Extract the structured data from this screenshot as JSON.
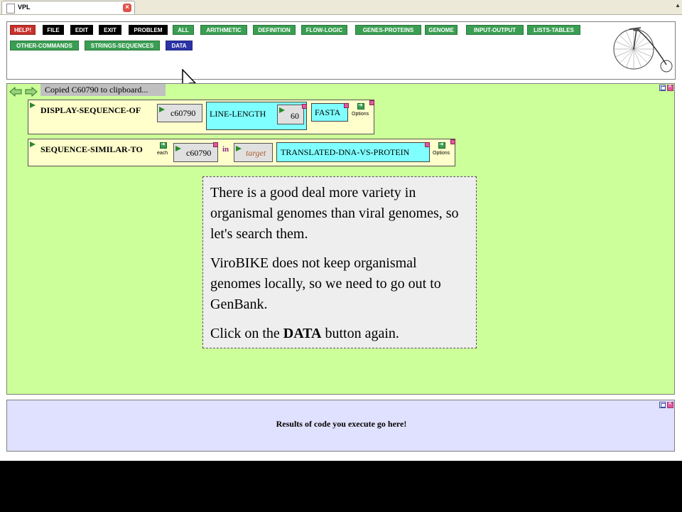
{
  "tab": {
    "title": "VPL",
    "close_icon": "tab-close-icon"
  },
  "toolbar": {
    "row1": [
      {
        "label": "HELP!",
        "color": "red"
      },
      {
        "label": "FILE",
        "color": "black"
      },
      {
        "label": "EDIT",
        "color": "black"
      },
      {
        "label": "EXIT",
        "color": "black"
      },
      {
        "label": "PROBLEM",
        "color": "black"
      },
      {
        "label": "ALL",
        "color": "green"
      },
      {
        "label": "ARITHMETIC",
        "color": "green"
      },
      {
        "label": "DEFINITION",
        "color": "green"
      },
      {
        "label": "FLOW-LOGIC",
        "color": "green"
      },
      {
        "label": "GENES-PROTEINS",
        "color": "green"
      },
      {
        "label": "GENOME",
        "color": "green"
      },
      {
        "label": "INPUT-OUTPUT",
        "color": "green"
      },
      {
        "label": "LISTS-TABLES",
        "color": "green"
      }
    ],
    "row2": [
      {
        "label": "OTHER-COMMANDS",
        "color": "green"
      },
      {
        "label": "STRINGS-SEQUENCES",
        "color": "green"
      },
      {
        "label": "DATA",
        "color": "blue"
      }
    ]
  },
  "workspace": {
    "clipboard_message": "Copied C60790 to clipboard...",
    "box1": {
      "label": "DISPLAY-SEQUENCE-OF",
      "arg1": "c60790",
      "line_length_label": "LINE-LENGTH",
      "line_length_value": "60",
      "format": "FASTA",
      "options_label": "Options"
    },
    "box2": {
      "label": "SEQUENCE-SIMILAR-TO",
      "each_label": "each",
      "arg1": "c60790",
      "in_label": "in",
      "target_placeholder": "target",
      "method": "TRANSLATED-DNA-VS-PROTEIN",
      "options_label": "Options"
    }
  },
  "note": {
    "p1": "There is a good deal more variety in organismal genomes than viral genomes, so let's search them.",
    "p2": "ViroBIKE does not keep organismal genomes locally, so we need to go out to GenBank.",
    "p3_before": "Click on the ",
    "p3_bold": "DATA",
    "p3_after": " button again."
  },
  "results": {
    "text": "Results of code you execute go here!"
  },
  "colors": {
    "workspace_bg": "#ccff99",
    "results_bg": "#e0e0ff",
    "green_button": "#3a9e52",
    "red_button": "#c8302c",
    "blue_button": "#2c33a6",
    "codebox_bg": "#ffffcc",
    "cyan_box": "#7fffff"
  }
}
